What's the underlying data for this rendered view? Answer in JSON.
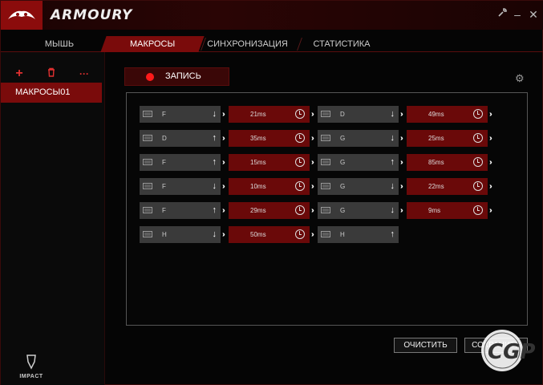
{
  "app": {
    "title": "ARMOURY"
  },
  "tabs": [
    {
      "label": "МЫШЬ"
    },
    {
      "label": "МАКРОСЫ"
    },
    {
      "label": "СИНХРОНИЗАЦИЯ"
    },
    {
      "label": "СТАТИСТИКА"
    }
  ],
  "sidebar": {
    "tools": {
      "add": "+",
      "delete": "trash-icon",
      "more": "···"
    },
    "macros": [
      {
        "label": "МАКРОСЫ01"
      }
    ],
    "brand": "IMPACT"
  },
  "record": {
    "label": "ЗАПИСЬ"
  },
  "macro_steps": [
    [
      {
        "type": "key",
        "key": "F",
        "dir": "down"
      },
      {
        "type": "delay",
        "value": "21ms"
      },
      {
        "type": "key",
        "key": "D",
        "dir": "down"
      },
      {
        "type": "delay",
        "value": "49ms"
      }
    ],
    [
      {
        "type": "key",
        "key": "D",
        "dir": "up"
      },
      {
        "type": "delay",
        "value": "35ms"
      },
      {
        "type": "key",
        "key": "G",
        "dir": "down"
      },
      {
        "type": "delay",
        "value": "25ms"
      }
    ],
    [
      {
        "type": "key",
        "key": "F",
        "dir": "up"
      },
      {
        "type": "delay",
        "value": "15ms"
      },
      {
        "type": "key",
        "key": "G",
        "dir": "up"
      },
      {
        "type": "delay",
        "value": "85ms"
      }
    ],
    [
      {
        "type": "key",
        "key": "F",
        "dir": "down"
      },
      {
        "type": "delay",
        "value": "10ms"
      },
      {
        "type": "key",
        "key": "G",
        "dir": "down"
      },
      {
        "type": "delay",
        "value": "22ms"
      }
    ],
    [
      {
        "type": "key",
        "key": "F",
        "dir": "up"
      },
      {
        "type": "delay",
        "value": "29ms"
      },
      {
        "type": "key",
        "key": "G",
        "dir": "down"
      },
      {
        "type": "delay",
        "value": "9ms"
      }
    ],
    [
      {
        "type": "key",
        "key": "H",
        "dir": "down"
      },
      {
        "type": "delay",
        "value": "50ms"
      },
      {
        "type": "key",
        "key": "H",
        "dir": "up"
      }
    ]
  ],
  "buttons": {
    "clear": "ОЧИСТИТЬ",
    "save": "СОХРАНИТЬ"
  },
  "colors": {
    "accent": "#7a0b0b",
    "record": "#ff1a1a"
  }
}
